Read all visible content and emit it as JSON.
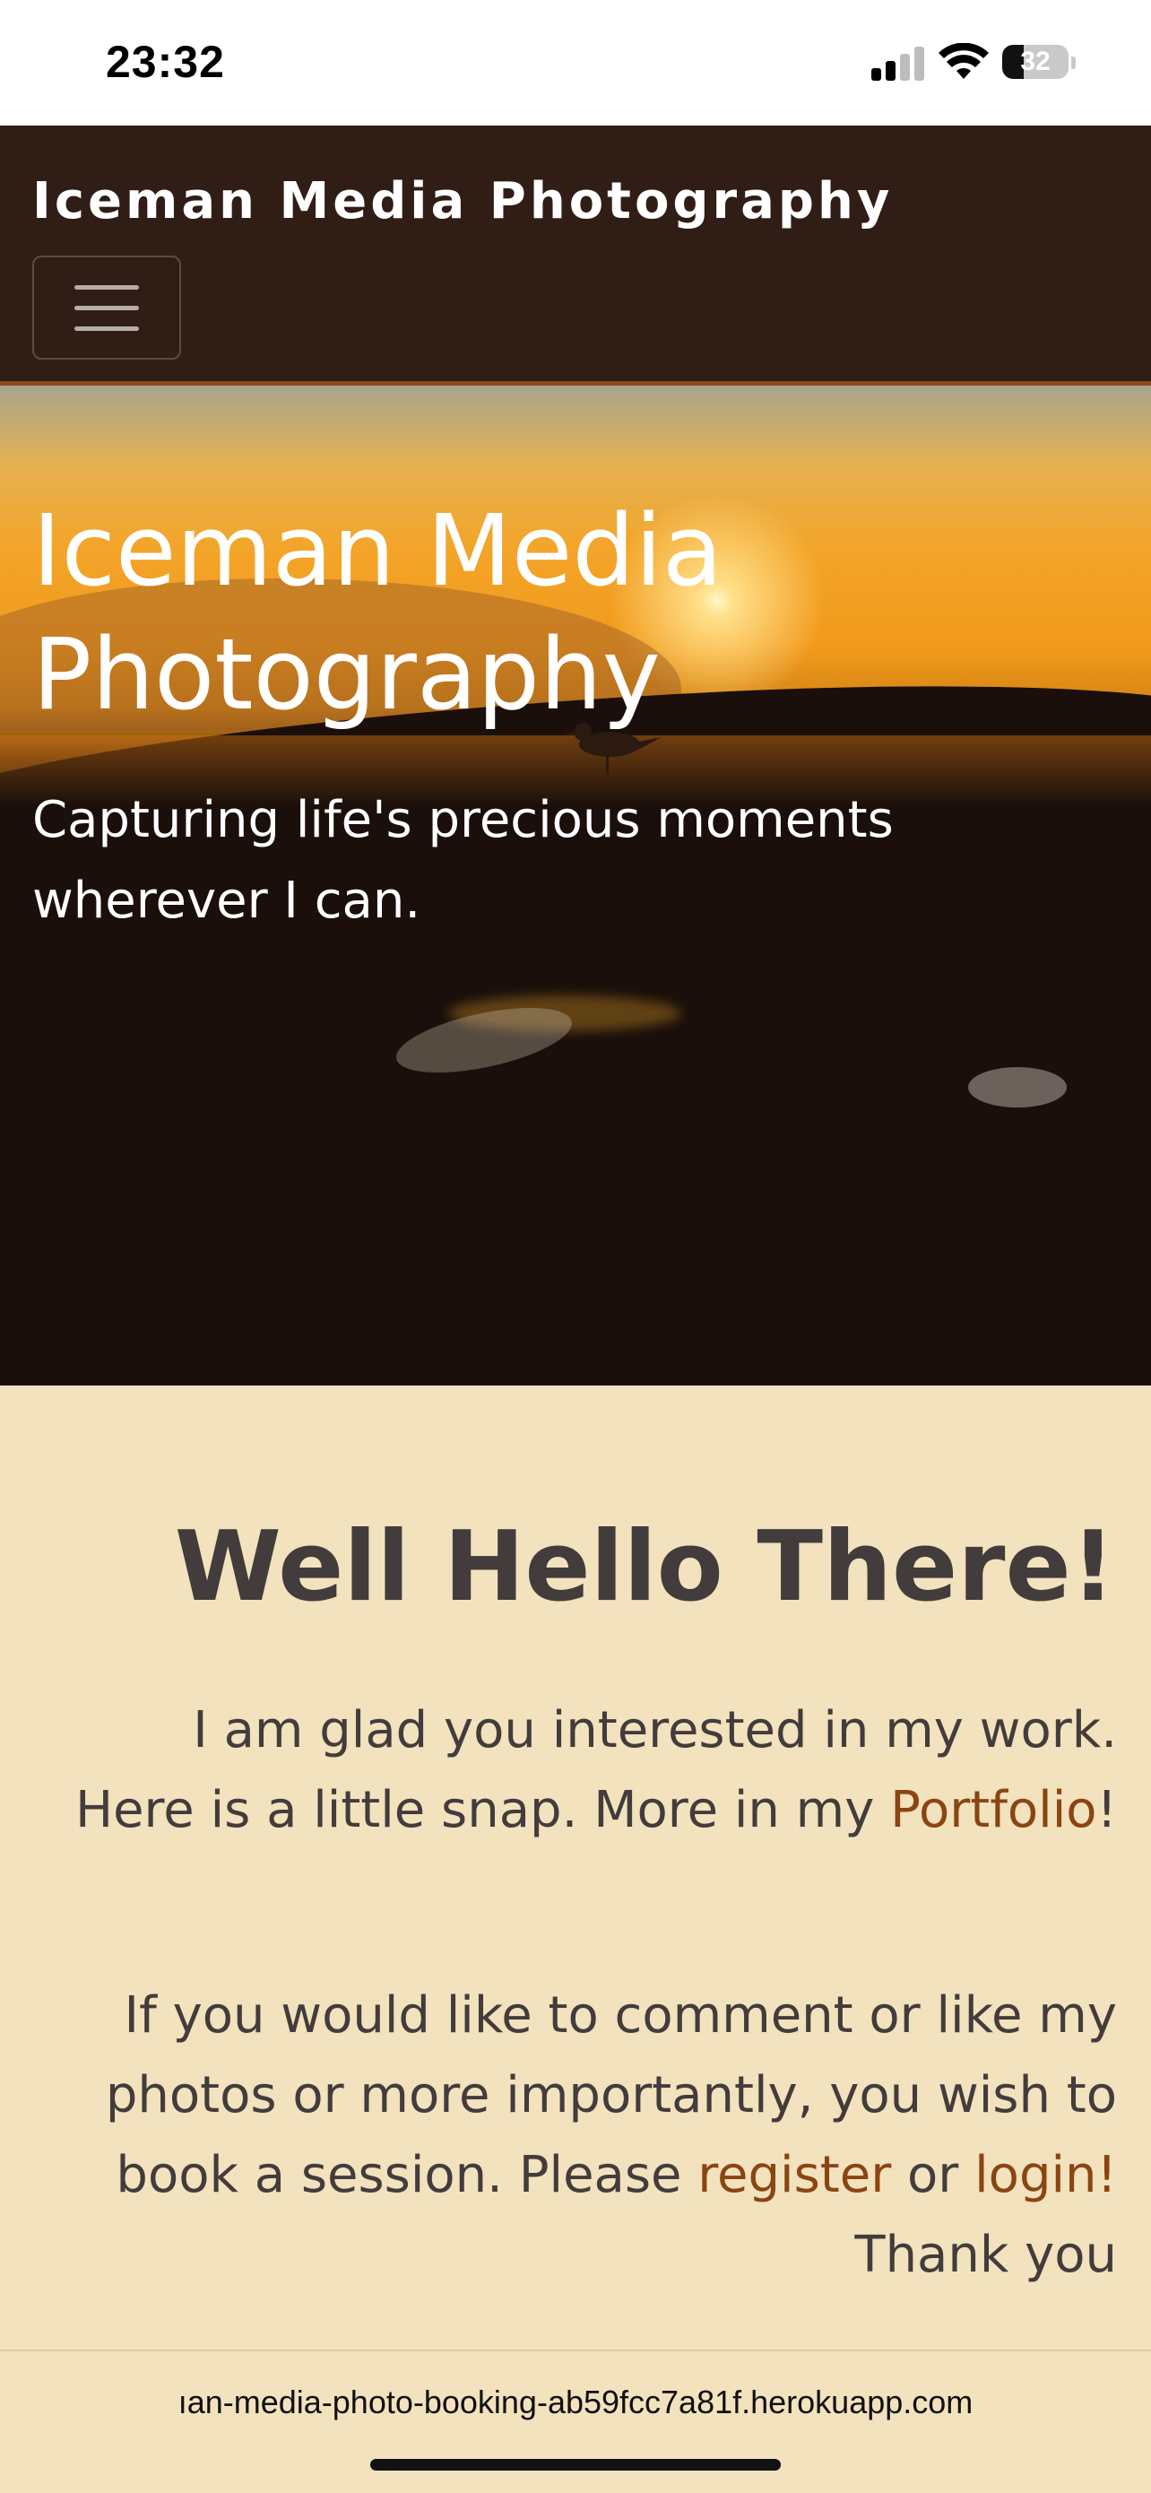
{
  "status_bar": {
    "time": "23:32",
    "battery_level": "32",
    "icons": [
      "signal-icon",
      "wifi-icon",
      "battery-icon"
    ]
  },
  "navbar": {
    "brand": "Iceman Media Photography",
    "toggle_icon": "hamburger-menu-icon",
    "background": "#2f1d16",
    "accent": "#8a4a1c"
  },
  "hero": {
    "title": "Iceman Media Photography",
    "subtitle": "Capturing life's precious moments wherever I can."
  },
  "welcome": {
    "heading": "Well Hello There!",
    "para1_text": "I am glad you interested in my work. Here is a little snap. More in my ",
    "para1_link": "Portfolio",
    "para1_end": "!",
    "para2_text": "If you would like to comment or like my photos or more importantly, you wish to book a session. Please ",
    "para2_link_register": "register",
    "para2_mid": " or ",
    "para2_link_login": "login!",
    "para2_end": " Thank you",
    "link_color": "#8a4512",
    "text_color": "#433c3c",
    "background": "#f2e2bd"
  },
  "browser": {
    "url": "ıan-media-photo-booking-ab59fcc7a81f.herokuapp.com"
  }
}
